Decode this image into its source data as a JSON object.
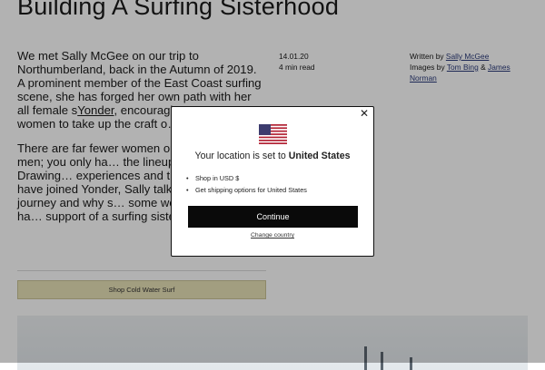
{
  "article": {
    "title": "Building A Surfing Sisterhood",
    "para1_part1": "We met Sally McGee on our trip to Northumberland, back in the Autumn of 2019. A prominent member of the East Coast surfing scene, she has forged her own path with her all female s",
    "para1_link": "Yonder",
    "para1_part2": ", encouraging more an… women to take up the craft o…",
    "para2": "There are far fewer women ou… surfing than men; you only ha… the lineup. But why? Drawing… experiences and those of the… have joined Yonder, Sally talk… her surfing journey and why s… some women benefit from ha… support of a surfing sisterhood.",
    "date": "14.01.20",
    "read_time": "4 min read",
    "written_by_label": "Written by",
    "author": "Sally McGee",
    "images_by_label": "Images by",
    "photographer1": "Tom Bing",
    "amp": "&",
    "photographer2": "James Norman",
    "shop_button": "Shop Cold Water Surf"
  },
  "modal": {
    "close_glyph": "✕",
    "location_prefix": "Your location is set to",
    "country": "United States",
    "bullets": [
      "Shop in USD $",
      "Get shipping options for United States"
    ],
    "continue_label": "Continue",
    "change_label": "Change country"
  },
  "colors": {
    "overlay": "#000000",
    "shop_button_bg": "#e9e2b8",
    "continue_bg": "#0a0a0a"
  }
}
